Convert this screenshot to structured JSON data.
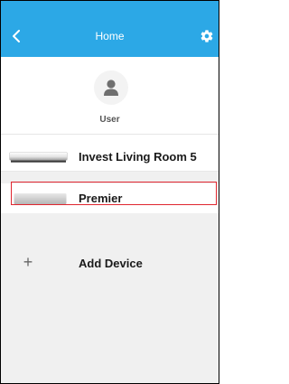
{
  "header": {
    "title": "Home",
    "back_icon": "chevron-left-icon",
    "settings_icon": "gear-icon",
    "background_color": "#2ca8e6"
  },
  "profile": {
    "avatar_icon": "user-avatar-icon",
    "name": "User"
  },
  "devices": [
    {
      "name": "Invest Living Room 5",
      "thumbnail_icon": "air-conditioner-icon",
      "selected": false
    },
    {
      "name": "Premier",
      "thumbnail_icon": "air-conditioner-icon",
      "selected": true
    }
  ],
  "add_device": {
    "icon": "plus-icon",
    "label": "Add Device"
  },
  "colors": {
    "accent": "#2ca8e6",
    "selection_border": "#e0262f"
  }
}
